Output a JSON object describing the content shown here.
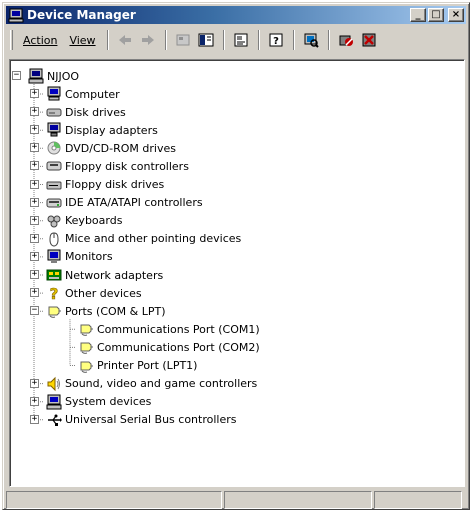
{
  "window": {
    "title": "Device Manager"
  },
  "caption_buttons": {
    "minimize": "_",
    "maximize": "□",
    "close": "×"
  },
  "menu": {
    "action": "Action",
    "view": "View"
  },
  "toolbar": {
    "buttons": [
      "back-icon",
      "forward-icon",
      "up-icon",
      "show-hide-tree-icon",
      "properties-icon",
      "help-icon",
      "scan-hardware-icon",
      "disable-device-icon",
      "uninstall-device-icon"
    ]
  },
  "tree": {
    "root": "NJJOO",
    "items": [
      {
        "label": "Computer",
        "icon": "computer-icon",
        "expanded": false
      },
      {
        "label": "Disk drives",
        "icon": "disk-drive-icon",
        "expanded": false
      },
      {
        "label": "Display adapters",
        "icon": "display-adapter-icon",
        "expanded": false
      },
      {
        "label": "DVD/CD-ROM drives",
        "icon": "cdrom-icon",
        "expanded": false
      },
      {
        "label": "Floppy disk controllers",
        "icon": "floppy-controller-icon",
        "expanded": false
      },
      {
        "label": "Floppy disk drives",
        "icon": "floppy-drive-icon",
        "expanded": false
      },
      {
        "label": "IDE ATA/ATAPI controllers",
        "icon": "ide-controller-icon",
        "expanded": false
      },
      {
        "label": "Keyboards",
        "icon": "keyboard-icon",
        "expanded": false
      },
      {
        "label": "Mice and other pointing devices",
        "icon": "mouse-icon",
        "expanded": false
      },
      {
        "label": "Monitors",
        "icon": "monitor-icon",
        "expanded": false
      },
      {
        "label": "Network adapters",
        "icon": "network-adapter-icon",
        "expanded": false
      },
      {
        "label": "Other devices",
        "icon": "unknown-device-icon",
        "expanded": false
      },
      {
        "label": "Ports (COM & LPT)",
        "icon": "port-icon",
        "expanded": true,
        "children": [
          {
            "label": "Communications Port (COM1)",
            "icon": "port-icon"
          },
          {
            "label": "Communications Port (COM2)",
            "icon": "port-icon"
          },
          {
            "label": "Printer Port (LPT1)",
            "icon": "port-icon"
          }
        ]
      },
      {
        "label": "Sound, video and game controllers",
        "icon": "sound-icon",
        "expanded": false
      },
      {
        "label": "System devices",
        "icon": "system-device-icon",
        "expanded": false
      },
      {
        "label": "Universal Serial Bus controllers",
        "icon": "usb-icon",
        "expanded": false
      }
    ]
  },
  "colors": {
    "title_active_start": "#0a246a",
    "title_active_end": "#a6caf0",
    "face": "#d4d0c8"
  }
}
